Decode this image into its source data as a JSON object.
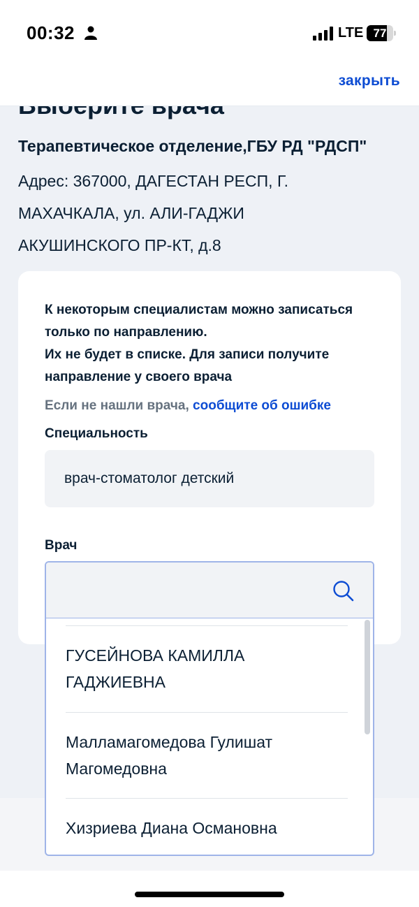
{
  "status_bar": {
    "time": "00:32",
    "network": "LTE",
    "battery": 77
  },
  "topbar": {
    "close_label": "закрыть"
  },
  "page": {
    "title": "Выберите врача",
    "org_name": "Терапевтическое отделение,ГБУ РД \"РДСП\"",
    "org_address": "Адрес: 367000, ДАГЕСТАН РЕСП, Г. МАХАЧКАЛА, ул. АЛИ-ГАДЖИ АКУШИНСКОГО ПР-КТ, д.8"
  },
  "card": {
    "notice": [
      "К некоторым специалистам можно записаться только по направлению.",
      "Их не будет в списке. Для записи получите направление у своего врача"
    ],
    "error_prefix": "Если не нашли врача,",
    "error_link": "сообщите об ошибке",
    "specialty_label": "Специальность",
    "specialty_value": "врач-стоматолог детский",
    "doctor_label": "Врач"
  },
  "dropdown": {
    "search_value": "",
    "items": [
      "ГУСЕЙНОВА КАМИЛЛА ГАДЖИЕВНА",
      "Малламагомедова Гулишат Магомедовна",
      "Хизриева Диана Османовна"
    ]
  },
  "colors": {
    "accent": "#0d4cd3",
    "text": "#0b1f33",
    "muted": "#66727f",
    "background": "#eef1f6",
    "dropdown_border": "#9fb4e8"
  }
}
